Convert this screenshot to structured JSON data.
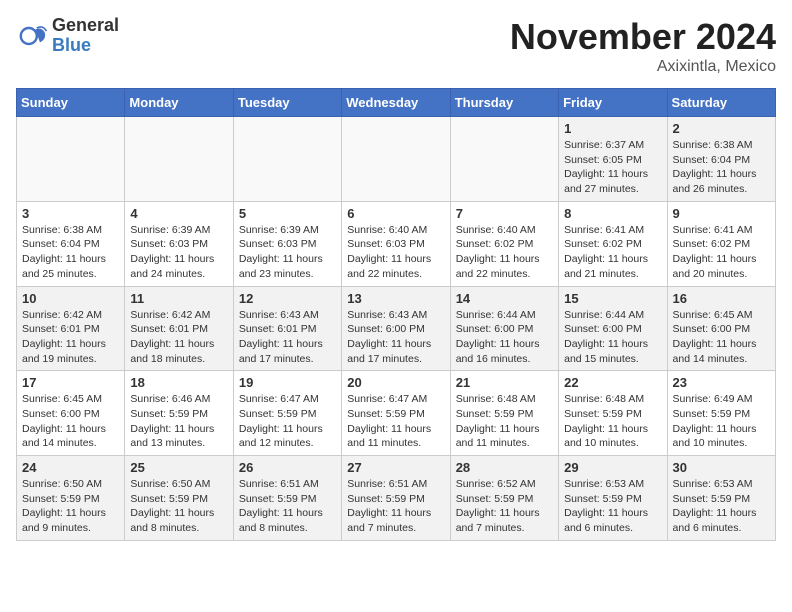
{
  "logo": {
    "general": "General",
    "blue": "Blue"
  },
  "title": "November 2024",
  "location": "Axixintla, Mexico",
  "days_of_week": [
    "Sunday",
    "Monday",
    "Tuesday",
    "Wednesday",
    "Thursday",
    "Friday",
    "Saturday"
  ],
  "weeks": [
    [
      {
        "day": "",
        "info": ""
      },
      {
        "day": "",
        "info": ""
      },
      {
        "day": "",
        "info": ""
      },
      {
        "day": "",
        "info": ""
      },
      {
        "day": "",
        "info": ""
      },
      {
        "day": "1",
        "info": "Sunrise: 6:37 AM\nSunset: 6:05 PM\nDaylight: 11 hours and 27 minutes."
      },
      {
        "day": "2",
        "info": "Sunrise: 6:38 AM\nSunset: 6:04 PM\nDaylight: 11 hours and 26 minutes."
      }
    ],
    [
      {
        "day": "3",
        "info": "Sunrise: 6:38 AM\nSunset: 6:04 PM\nDaylight: 11 hours and 25 minutes."
      },
      {
        "day": "4",
        "info": "Sunrise: 6:39 AM\nSunset: 6:03 PM\nDaylight: 11 hours and 24 minutes."
      },
      {
        "day": "5",
        "info": "Sunrise: 6:39 AM\nSunset: 6:03 PM\nDaylight: 11 hours and 23 minutes."
      },
      {
        "day": "6",
        "info": "Sunrise: 6:40 AM\nSunset: 6:03 PM\nDaylight: 11 hours and 22 minutes."
      },
      {
        "day": "7",
        "info": "Sunrise: 6:40 AM\nSunset: 6:02 PM\nDaylight: 11 hours and 22 minutes."
      },
      {
        "day": "8",
        "info": "Sunrise: 6:41 AM\nSunset: 6:02 PM\nDaylight: 11 hours and 21 minutes."
      },
      {
        "day": "9",
        "info": "Sunrise: 6:41 AM\nSunset: 6:02 PM\nDaylight: 11 hours and 20 minutes."
      }
    ],
    [
      {
        "day": "10",
        "info": "Sunrise: 6:42 AM\nSunset: 6:01 PM\nDaylight: 11 hours and 19 minutes."
      },
      {
        "day": "11",
        "info": "Sunrise: 6:42 AM\nSunset: 6:01 PM\nDaylight: 11 hours and 18 minutes."
      },
      {
        "day": "12",
        "info": "Sunrise: 6:43 AM\nSunset: 6:01 PM\nDaylight: 11 hours and 17 minutes."
      },
      {
        "day": "13",
        "info": "Sunrise: 6:43 AM\nSunset: 6:00 PM\nDaylight: 11 hours and 17 minutes."
      },
      {
        "day": "14",
        "info": "Sunrise: 6:44 AM\nSunset: 6:00 PM\nDaylight: 11 hours and 16 minutes."
      },
      {
        "day": "15",
        "info": "Sunrise: 6:44 AM\nSunset: 6:00 PM\nDaylight: 11 hours and 15 minutes."
      },
      {
        "day": "16",
        "info": "Sunrise: 6:45 AM\nSunset: 6:00 PM\nDaylight: 11 hours and 14 minutes."
      }
    ],
    [
      {
        "day": "17",
        "info": "Sunrise: 6:45 AM\nSunset: 6:00 PM\nDaylight: 11 hours and 14 minutes."
      },
      {
        "day": "18",
        "info": "Sunrise: 6:46 AM\nSunset: 5:59 PM\nDaylight: 11 hours and 13 minutes."
      },
      {
        "day": "19",
        "info": "Sunrise: 6:47 AM\nSunset: 5:59 PM\nDaylight: 11 hours and 12 minutes."
      },
      {
        "day": "20",
        "info": "Sunrise: 6:47 AM\nSunset: 5:59 PM\nDaylight: 11 hours and 11 minutes."
      },
      {
        "day": "21",
        "info": "Sunrise: 6:48 AM\nSunset: 5:59 PM\nDaylight: 11 hours and 11 minutes."
      },
      {
        "day": "22",
        "info": "Sunrise: 6:48 AM\nSunset: 5:59 PM\nDaylight: 11 hours and 10 minutes."
      },
      {
        "day": "23",
        "info": "Sunrise: 6:49 AM\nSunset: 5:59 PM\nDaylight: 11 hours and 10 minutes."
      }
    ],
    [
      {
        "day": "24",
        "info": "Sunrise: 6:50 AM\nSunset: 5:59 PM\nDaylight: 11 hours and 9 minutes."
      },
      {
        "day": "25",
        "info": "Sunrise: 6:50 AM\nSunset: 5:59 PM\nDaylight: 11 hours and 8 minutes."
      },
      {
        "day": "26",
        "info": "Sunrise: 6:51 AM\nSunset: 5:59 PM\nDaylight: 11 hours and 8 minutes."
      },
      {
        "day": "27",
        "info": "Sunrise: 6:51 AM\nSunset: 5:59 PM\nDaylight: 11 hours and 7 minutes."
      },
      {
        "day": "28",
        "info": "Sunrise: 6:52 AM\nSunset: 5:59 PM\nDaylight: 11 hours and 7 minutes."
      },
      {
        "day": "29",
        "info": "Sunrise: 6:53 AM\nSunset: 5:59 PM\nDaylight: 11 hours and 6 minutes."
      },
      {
        "day": "30",
        "info": "Sunrise: 6:53 AM\nSunset: 5:59 PM\nDaylight: 11 hours and 6 minutes."
      }
    ]
  ]
}
